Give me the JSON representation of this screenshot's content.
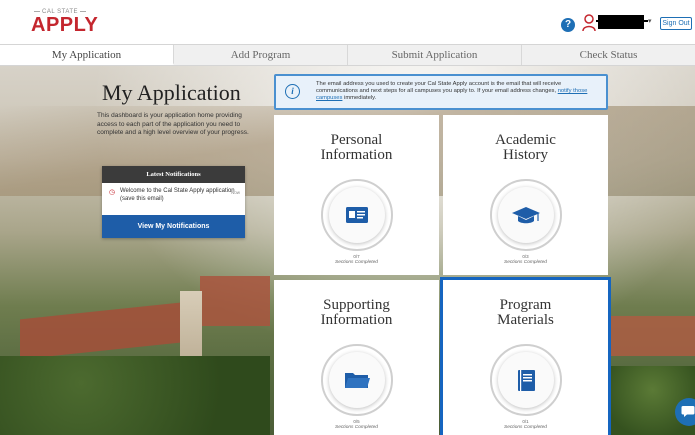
{
  "header": {
    "logo_top": "CAL STATE",
    "logo_main": "APPLY",
    "help_icon": "help-icon",
    "user_icon": "user-icon",
    "sign_out_label": "Sign Out"
  },
  "tabs": [
    {
      "label": "My Application",
      "active": true
    },
    {
      "label": "Add Program",
      "active": false
    },
    {
      "label": "Submit Application",
      "active": false
    },
    {
      "label": "Check Status",
      "active": false
    }
  ],
  "main": {
    "title": "My Application",
    "intro": "This dashboard is your application home providing access to each part of the application you need to complete and a high level overview of your progress."
  },
  "notifications": {
    "header": "Latest Notifications",
    "items": [
      {
        "text": "Welcome to the Cal State Apply application (save this email)",
        "time": "Now",
        "icon": "notification-icon"
      }
    ],
    "button_label": "View My Notifications"
  },
  "banner": {
    "text": "The email address you used to create your Cal State Apply account is the email that will receive communications and next steps for all campuses you apply to. If your email address changes,",
    "link": "notify those campuses",
    "suffix": "immediately."
  },
  "tiles": [
    {
      "title_line1": "Personal",
      "title_line2": "Information",
      "count": "0/7",
      "caption": "Sections Completed",
      "icon": "id-card-icon"
    },
    {
      "title_line1": "Academic",
      "title_line2": "History",
      "count": "0/3",
      "caption": "Sections Completed",
      "icon": "graduation-cap-icon"
    },
    {
      "title_line1": "Supporting",
      "title_line2": "Information",
      "count": "0/5",
      "caption": "Sections Completed",
      "icon": "folder-icon"
    },
    {
      "title_line1": "Program",
      "title_line2": "Materials",
      "count": "0/1",
      "caption": "Sections Completed",
      "icon": "book-icon"
    }
  ],
  "colors": {
    "brand_red": "#c4262e",
    "brand_blue": "#1e6fb5",
    "highlight_blue": "#1565c0"
  }
}
